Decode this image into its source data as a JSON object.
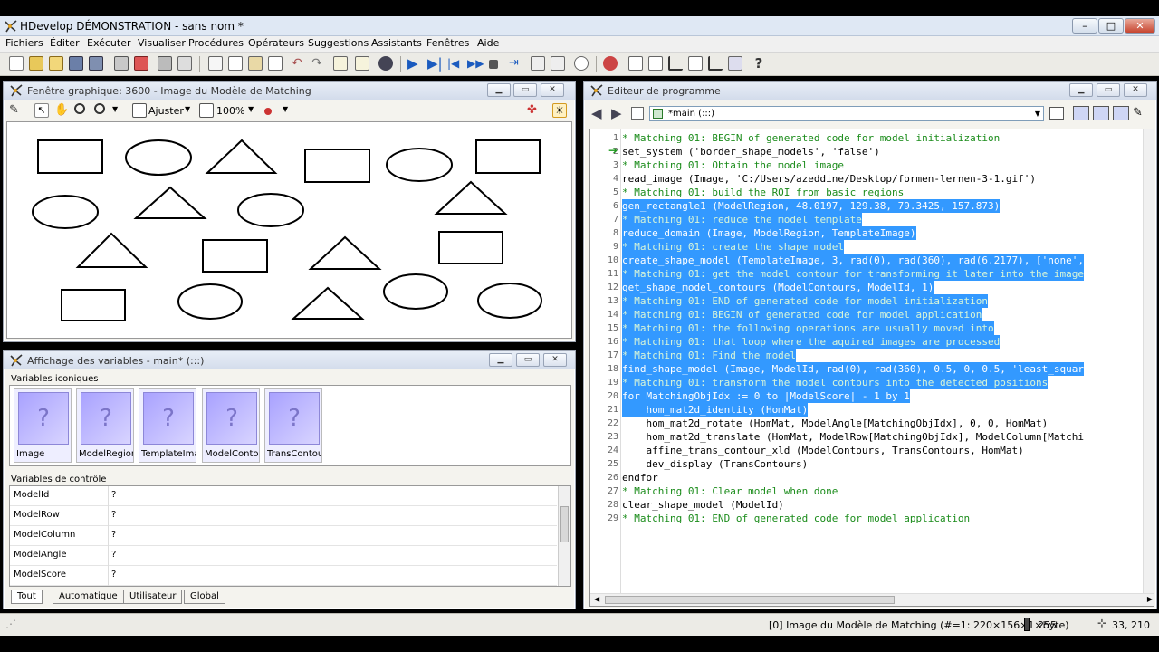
{
  "app": {
    "title": "HDevelop DÉMONSTRATION - sans nom *",
    "minimize": "–",
    "maximize": "□",
    "close": "✕"
  },
  "menu": [
    "Fichiers",
    "Éditer",
    "Exécuter",
    "Visualiser",
    "Procédures",
    "Opérateurs",
    "Suggestions",
    "Assistants",
    "Fenêtres",
    "Aide"
  ],
  "graphics_window": {
    "title": "Fenêtre graphique: 3600 - Image du Modèle de Matching",
    "zoom_fit_label": "Ajuster",
    "zoom_value": "100%"
  },
  "variables_window": {
    "title": "Affichage des variables - main* (:::)",
    "iconic_label": "Variables iconiques",
    "control_label": "Variables de contrôle",
    "iconic": [
      {
        "label": "Image",
        "glyph": "?"
      },
      {
        "label": "ModelRegion",
        "glyph": "?"
      },
      {
        "label": "TemplateImag",
        "glyph": "?"
      },
      {
        "label": "ModelContou",
        "glyph": "?"
      },
      {
        "label": "TransContour",
        "glyph": "?"
      }
    ],
    "control": [
      {
        "name": "ModelId",
        "value": "?"
      },
      {
        "name": "ModelRow",
        "value": "?"
      },
      {
        "name": "ModelColumn",
        "value": "?"
      },
      {
        "name": "ModelAngle",
        "value": "?"
      },
      {
        "name": "ModelScore",
        "value": "?"
      }
    ],
    "tabs": [
      "Tout",
      "Automatique",
      "Utilisateur",
      "Global"
    ]
  },
  "editor": {
    "title": "Editeur de programme",
    "procedure": "*main (:::)",
    "lines": [
      {
        "n": "1",
        "t": "* Matching 01: BEGIN of generated code for model initialization",
        "c": true,
        "s": false
      },
      {
        "n": "2",
        "t": "set_system ('border_shape_models', 'false')",
        "c": false,
        "s": false
      },
      {
        "n": "3",
        "t": "* Matching 01: Obtain the model image",
        "c": true,
        "s": false
      },
      {
        "n": "4",
        "t": "read_image (Image, 'C:/Users/azeddine/Desktop/formen-lernen-3-1.gif')",
        "c": false,
        "s": false
      },
      {
        "n": "5",
        "t": "* Matching 01: build the ROI from basic regions",
        "c": true,
        "s": false
      },
      {
        "n": "6",
        "t": "gen_rectangle1 (ModelRegion, 48.0197, 129.38, 79.3425, 157.873)",
        "c": false,
        "s": true
      },
      {
        "n": "7",
        "t": "* Matching 01: reduce the model template",
        "c": true,
        "s": true
      },
      {
        "n": "8",
        "t": "reduce_domain (Image, ModelRegion, TemplateImage)",
        "c": false,
        "s": true
      },
      {
        "n": "9",
        "t": "* Matching 01: create the shape model",
        "c": true,
        "s": true
      },
      {
        "n": "10",
        "t": "create_shape_model (TemplateImage, 3, rad(0), rad(360), rad(6.2177), ['none',",
        "c": false,
        "s": true
      },
      {
        "n": "11",
        "t": "* Matching 01: get the model contour for transforming it later into the image",
        "c": true,
        "s": true
      },
      {
        "n": "12",
        "t": "get_shape_model_contours (ModelContours, ModelId, 1)",
        "c": false,
        "s": true
      },
      {
        "n": "13",
        "t": "* Matching 01: END of generated code for model initialization",
        "c": true,
        "s": true
      },
      {
        "n": "14",
        "t": "* Matching 01: BEGIN of generated code for model application",
        "c": true,
        "s": true
      },
      {
        "n": "15",
        "t": "* Matching 01: the following operations are usually moved into",
        "c": true,
        "s": true
      },
      {
        "n": "16",
        "t": "* Matching 01: that loop where the aquired images are processed",
        "c": true,
        "s": true
      },
      {
        "n": "17",
        "t": "* Matching 01: Find the model",
        "c": true,
        "s": true
      },
      {
        "n": "18",
        "t": "find_shape_model (Image, ModelId, rad(0), rad(360), 0.5, 0, 0.5, 'least_squar",
        "c": false,
        "s": true
      },
      {
        "n": "19",
        "t": "* Matching 01: transform the model contours into the detected positions",
        "c": true,
        "s": true
      },
      {
        "n": "20",
        "t": "for MatchingObjIdx := 0 to |ModelScore| - 1 by 1",
        "c": false,
        "s": true
      },
      {
        "n": "21",
        "t": "    hom_mat2d_identity (HomMat)",
        "c": false,
        "s": true
      },
      {
        "n": "22",
        "t": "    hom_mat2d_rotate (HomMat, ModelAngle[MatchingObjIdx], 0, 0, HomMat)",
        "c": false,
        "s": false
      },
      {
        "n": "23",
        "t": "    hom_mat2d_translate (HomMat, ModelRow[MatchingObjIdx], ModelColumn[Matchi",
        "c": false,
        "s": false
      },
      {
        "n": "24",
        "t": "    affine_trans_contour_xld (ModelContours, TransContours, HomMat)",
        "c": false,
        "s": false
      },
      {
        "n": "25",
        "t": "    dev_display (TransContours)",
        "c": false,
        "s": false
      },
      {
        "n": "26",
        "t": "endfor",
        "c": false,
        "s": false
      },
      {
        "n": "27",
        "t": "* Matching 01: Clear model when done",
        "c": true,
        "s": false
      },
      {
        "n": "28",
        "t": "clear_shape_model (ModelId)",
        "c": false,
        "s": false
      },
      {
        "n": "29",
        "t": "* Matching 01: END of generated code for model application",
        "c": true,
        "s": false
      }
    ]
  },
  "status": {
    "image_info": "[0] Image du Modèle de Matching (#=1: 220×156×1×byte)",
    "gray_value": "255",
    "coords": "33, 210"
  }
}
